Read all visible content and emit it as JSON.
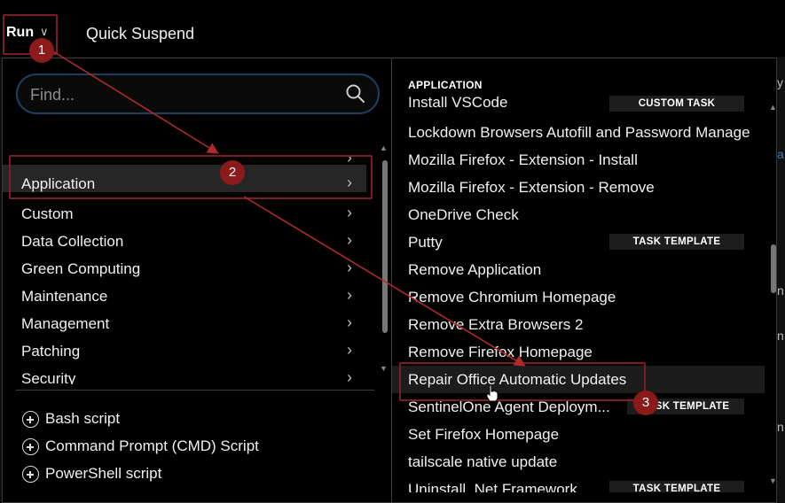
{
  "topbar": {
    "run_label": "Run",
    "quick_suspend_label": "Quick Suspend"
  },
  "search": {
    "placeholder": "Find..."
  },
  "categories": [
    {
      "label": ""
    },
    {
      "label": "Application"
    },
    {
      "label": "Custom"
    },
    {
      "label": "Data Collection"
    },
    {
      "label": "Green Computing"
    },
    {
      "label": "Maintenance"
    },
    {
      "label": "Management"
    },
    {
      "label": "Patching"
    },
    {
      "label": "Security"
    }
  ],
  "selected_category": "Application",
  "add_items": [
    {
      "label": "Bash script"
    },
    {
      "label": "Command Prompt (CMD) Script"
    },
    {
      "label": "PowerShell script"
    }
  ],
  "right_pane": {
    "section_header": "APPLICATION",
    "tasks": [
      {
        "label": "Install VSCode",
        "badge": "CUSTOM TASK"
      },
      {
        "label": "Lockdown Browsers Autofill and Password Manage",
        "badge": ""
      },
      {
        "label": "Mozilla Firefox - Extension - Install",
        "badge": ""
      },
      {
        "label": "Mozilla Firefox - Extension - Remove",
        "badge": ""
      },
      {
        "label": "OneDrive Check",
        "badge": ""
      },
      {
        "label": "Putty",
        "badge": "TASK TEMPLATE"
      },
      {
        "label": "Remove Application",
        "badge": ""
      },
      {
        "label": "Remove Chromium Homepage",
        "badge": ""
      },
      {
        "label": "Remove Extra Browsers 2",
        "badge": ""
      },
      {
        "label": "Remove Firefox Homepage",
        "badge": ""
      },
      {
        "label": "Repair Office Automatic Updates",
        "badge": ""
      },
      {
        "label": "SentinelOne Agent Deploym...",
        "badge": "TASK TEMPLATE"
      },
      {
        "label": "Set Firefox Homepage",
        "badge": ""
      },
      {
        "label": "tailscale native update",
        "badge": ""
      },
      {
        "label": "Uninstall .Net Framework",
        "badge": "TASK TEMPLATE"
      }
    ]
  },
  "markers": [
    "1",
    "2",
    "3"
  ],
  "background_edge_text": [
    "y",
    "a",
    "n",
    "n",
    "n"
  ],
  "colors": {
    "accent_red": "#7a1e24",
    "marker_red": "#8b1a1a",
    "arrow_red": "#b02a2a",
    "search_border": "#1f3f5c",
    "background": "#000000"
  }
}
